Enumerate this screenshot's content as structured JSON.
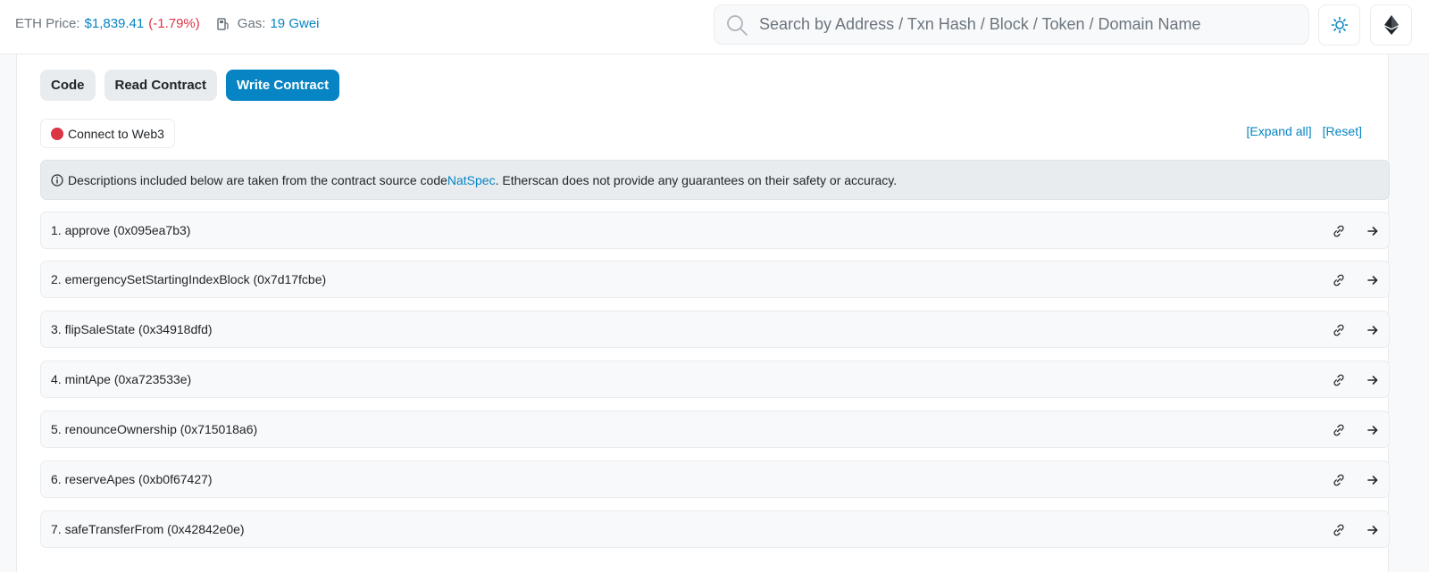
{
  "header": {
    "eth_price_label": "ETH Price:",
    "eth_price_value": "$1,839.41",
    "eth_price_change": "(-1.79%)",
    "gas_label": "Gas:",
    "gas_value": "19 Gwei",
    "search_placeholder": "Search by Address / Txn Hash / Block / Token / Domain Name",
    "icons": [
      "gas-pump-icon",
      "search-icon",
      "sun-icon",
      "ethereum-icon"
    ]
  },
  "tabs": [
    {
      "label": "Code",
      "active": false
    },
    {
      "label": "Read Contract",
      "active": false
    },
    {
      "label": "Write Contract",
      "active": true
    }
  ],
  "connect": {
    "label": "Connect to Web3",
    "status_color": "#dc3545"
  },
  "links": {
    "expand_all": "[Expand all]",
    "reset": "[Reset]"
  },
  "notice": {
    "text_before": "Descriptions included below are taken from the contract source code ",
    "link": "NatSpec",
    "text_after": ". Etherscan does not provide any guarantees on their safety or accuracy."
  },
  "functions": [
    {
      "label": "1. approve (0x095ea7b3)"
    },
    {
      "label": "2. emergencySetStartingIndexBlock (0x7d17fcbe)"
    },
    {
      "label": "3. flipSaleState (0x34918dfd)"
    },
    {
      "label": "4. mintApe (0xa723533e)"
    },
    {
      "label": "5. renounceOwnership (0x715018a6)"
    },
    {
      "label": "6. reserveApes (0xb0f67427)"
    },
    {
      "label": "7. safeTransferFrom (0x42842e0e)"
    }
  ],
  "colors": {
    "accent": "#0784c3",
    "negative": "#dc3545"
  }
}
